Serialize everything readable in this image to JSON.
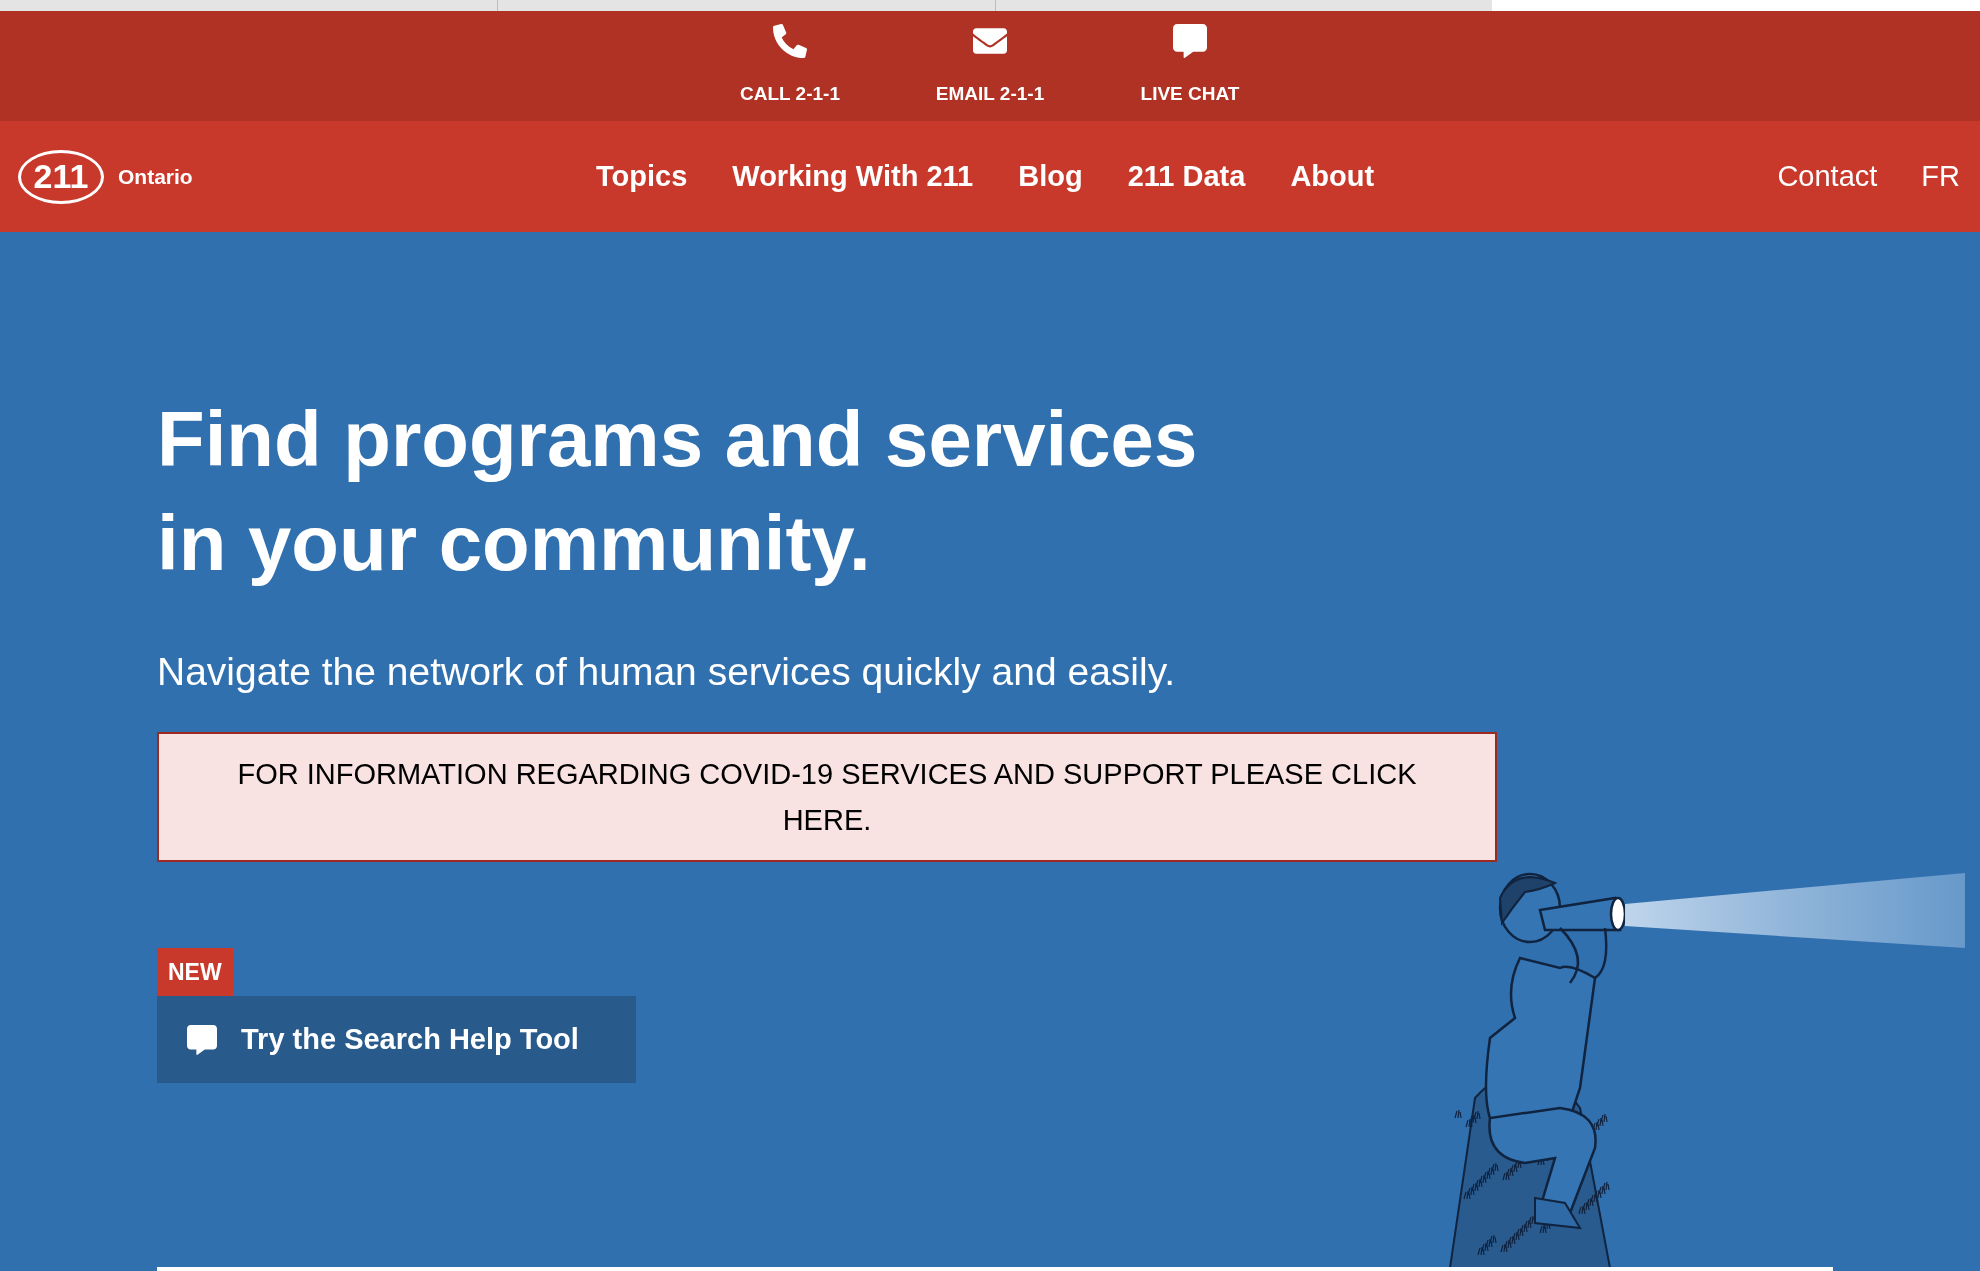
{
  "contact_bar": [
    {
      "kind": "phone",
      "label": "CALL 2-1-1"
    },
    {
      "kind": "email",
      "label": "EMAIL 2-1-1"
    },
    {
      "kind": "chat",
      "label": "LIVE CHAT"
    }
  ],
  "logo": {
    "mark": "211",
    "name": "Ontario"
  },
  "nav": {
    "links": [
      "Topics",
      "Working With 211",
      "Blog",
      "211 Data",
      "About"
    ],
    "secondary": [
      "Contact",
      "FR"
    ]
  },
  "hero": {
    "heading": [
      "Find programs and services",
      "in your community."
    ],
    "subtitle": "Navigate the network of human services quickly and easily.",
    "notice": "FOR INFORMATION REGARDING COVID-19 SERVICES AND SUPPORT PLEASE CLICK HERE.",
    "badge": "NEW",
    "button": "Try the Search Help Tool"
  }
}
